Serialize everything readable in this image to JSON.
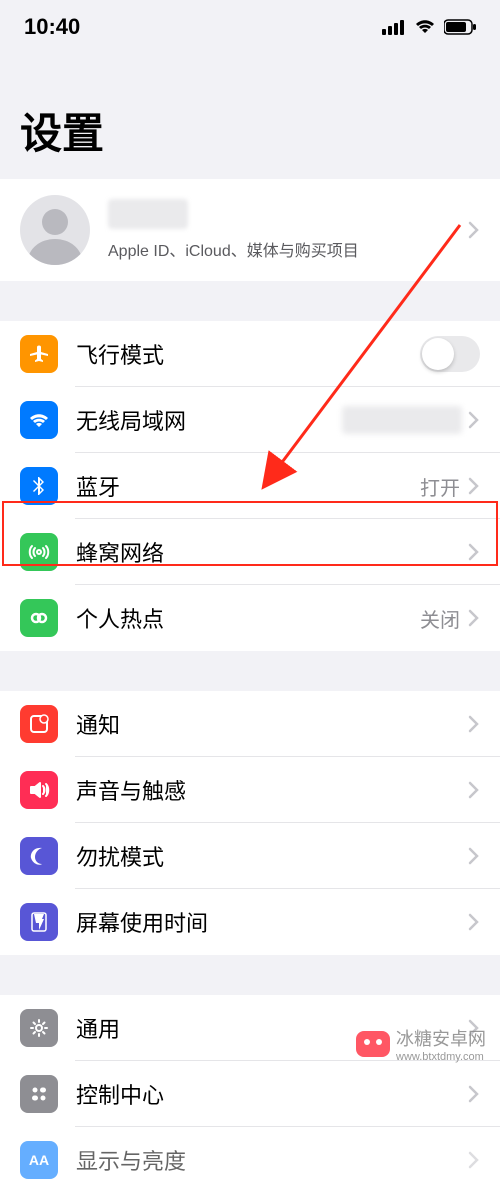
{
  "status": {
    "time": "10:40"
  },
  "header": {
    "title": "设置"
  },
  "profile": {
    "subtitle": "Apple ID、iCloud、媒体与购买项目"
  },
  "rows": {
    "airplane": {
      "label": "飞行模式",
      "icon_color": "#ff9500"
    },
    "wifi": {
      "label": "无线局域网",
      "icon_color": "#007aff"
    },
    "bluetooth": {
      "label": "蓝牙",
      "value": "打开",
      "icon_color": "#007aff"
    },
    "cellular": {
      "label": "蜂窝网络",
      "icon_color": "#34c759"
    },
    "hotspot": {
      "label": "个人热点",
      "value": "关闭",
      "icon_color": "#34c759"
    },
    "notifications": {
      "label": "通知",
      "icon_color": "#ff3b30"
    },
    "sound": {
      "label": "声音与触感",
      "icon_color": "#ff3b30"
    },
    "dnd": {
      "label": "勿扰模式",
      "icon_color": "#5856d6"
    },
    "screentime": {
      "label": "屏幕使用时间",
      "icon_color": "#5856d6"
    },
    "general": {
      "label": "通用",
      "icon_color": "#8e8e93"
    },
    "control": {
      "label": "控制中心",
      "icon_color": "#8e8e93"
    },
    "display": {
      "label": "显示与亮度",
      "icon_color": "#007aff"
    }
  },
  "watermark": {
    "text": "冰糖安卓网",
    "url": "www.btxtdmy.com"
  }
}
